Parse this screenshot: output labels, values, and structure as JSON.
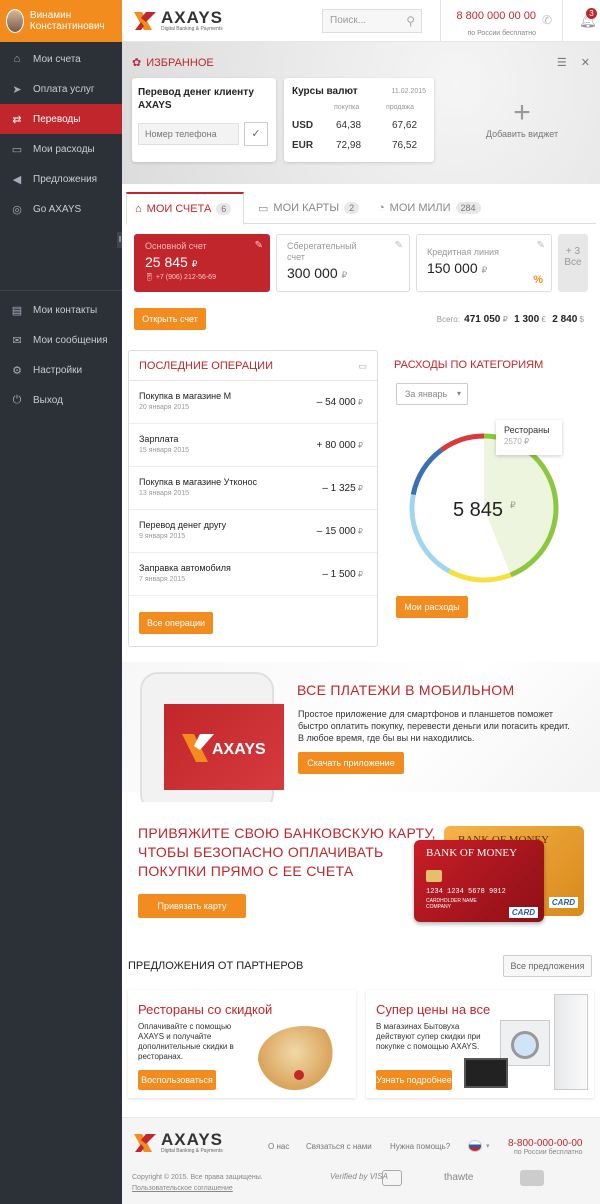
{
  "user": {
    "name": "Винамин Константинович"
  },
  "sidebar": {
    "items": [
      {
        "label": "Мои счета",
        "icon": "bank-icon",
        "glyph": "⌂"
      },
      {
        "label": "Оплата услуг",
        "icon": "send-icon",
        "glyph": "➤"
      },
      {
        "label": "Переводы",
        "icon": "transfer-icon",
        "glyph": "⇄"
      },
      {
        "label": "Мои расходы",
        "icon": "wallet-icon",
        "glyph": "▭"
      },
      {
        "label": "Предложения",
        "icon": "megaphone-icon",
        "glyph": "◀"
      },
      {
        "label": "Go AXAYS",
        "icon": "go-icon",
        "glyph": "◎"
      }
    ],
    "items2": [
      {
        "label": "Мои контакты",
        "icon": "contacts-icon",
        "glyph": "▤"
      },
      {
        "label": "Мои сообщения",
        "icon": "mail-icon",
        "glyph": "✉"
      },
      {
        "label": "Настройки",
        "icon": "gear-icon",
        "glyph": "⚙"
      },
      {
        "label": "Выход",
        "icon": "power-icon",
        "glyph": "⏻"
      }
    ],
    "active_index": 2
  },
  "header": {
    "logo": "AXAYS",
    "logo_sub": "Digital Banking & Payments",
    "search_placeholder": "Поиск...",
    "phone": "8 800 000 00 00",
    "phone_note": "по России бесплатно",
    "notifications": "3"
  },
  "favorites": {
    "title": "ИЗБРАННОЕ",
    "transfer_widget": {
      "title": "Перевод денег клиенту AXAYS",
      "placeholder": "Номер телефона"
    },
    "rates_widget": {
      "title": "Курсы валют",
      "date": "11.02.2015",
      "buy_label": "покупка",
      "sell_label": "продажа",
      "rows": [
        {
          "currency": "USD",
          "buy": "64,38",
          "sell": "67,62"
        },
        {
          "currency": "EUR",
          "buy": "72,98",
          "sell": "76,52"
        }
      ]
    },
    "add_widget": "Добавить виджет"
  },
  "tabs": [
    {
      "label": "МОИ СЧЕТА",
      "count": "6"
    },
    {
      "label": "МОИ КАРТЫ",
      "count": "2"
    },
    {
      "label": "МОИ МИЛИ",
      "count": "284"
    }
  ],
  "accounts": [
    {
      "name": "Основной счет",
      "value": "25 845",
      "currency": "₽",
      "sub": "+7 (906) 212-56-69"
    },
    {
      "name": "Сберегательный счет",
      "value": "300 000",
      "currency": "₽"
    },
    {
      "name": "Кредитная линия",
      "value": "150 000",
      "currency": "₽",
      "extra": "%"
    }
  ],
  "more_accounts": "+ 3 Все",
  "open_account": "Открыть счет",
  "totals": {
    "label": "Всего:",
    "rub": "471 050",
    "rub_cur": "₽",
    "eur": "1 300",
    "eur_cur": "€",
    "usd": "2 840",
    "usd_cur": "$"
  },
  "operations": {
    "title": "ПОСЛЕДНИЕ ОПЕРАЦИИ",
    "rows": [
      {
        "name": "Покупка в магазине М",
        "date": "20 января 2015",
        "amount": "– 54 000",
        "cur": "₽"
      },
      {
        "name": "Зарплата",
        "date": "15 января 2015",
        "amount": "+ 80 000",
        "cur": "₽"
      },
      {
        "name": "Покупка в магазине Утконос",
        "date": "13 января 2015",
        "amount": "– 1 325",
        "cur": "₽"
      },
      {
        "name": "Перевод денег другу",
        "date": "9 января 2015",
        "amount": "– 15 000",
        "cur": "₽"
      },
      {
        "name": "Заправка автомобиля",
        "date": "7 января 2015",
        "amount": "– 1 500",
        "cur": "₽"
      }
    ],
    "all_button": "Все операции"
  },
  "categories": {
    "title": "РАСХОДЫ ПО КАТЕГОРИЯМ",
    "period": "За январь",
    "total": "5 845",
    "total_cur": "₽",
    "tooltip_name": "Рестораны",
    "tooltip_value": "2570",
    "tooltip_cur": "₽",
    "button": "Мои расходы"
  },
  "chart_data": {
    "type": "pie",
    "total": 5845,
    "labels": [
      "Рестораны"
    ],
    "values": [
      2570
    ],
    "colors": [
      "#8dc63f",
      "#f7e03c",
      "#9fd6ee",
      "#3b6fb6",
      "#d93a3a"
    ]
  },
  "mobile_promo": {
    "title": "ВСЕ ПЛАТЕЖИ В МОБИЛЬНОМ",
    "text": "Простое приложение для смартфонов и планшетов поможет быстро оплатить покупку, перевести деньги или погасить кредит. В любое время, где бы вы ни находились.",
    "button": "Скачать приложение"
  },
  "card_promo": {
    "title_l1": "ПРИВЯЖИТЕ СВОЮ БАНКОВСКУЮ КАРТУ,",
    "title_l2": "ЧТОБЫ БЕЗОПАСНО ОПЛАЧИВАТЬ",
    "title_l3": "ПОКУПКИ ПРЯМО С ЕЕ СЧЕТА",
    "button": "Привязать карту",
    "card_bank": "BANK OF MONEY",
    "card_number": "1234 1234 5678 9012",
    "card_holder": "CARDHOLDER NAME",
    "card_company": "COMPANY",
    "card_brand": "CARD"
  },
  "partners": {
    "title": "ПРЕДЛОЖЕНИЯ ОТ ПАРТНЕРОВ",
    "all_button": "Все предложения",
    "offers": [
      {
        "title": "Рестораны со скидкой",
        "text": "Оплачивайте с помощью AXAYS и получайте дополнительные скидки в ресторанах.",
        "button": "Воспользоваться"
      },
      {
        "title": "Супер цены на все",
        "text": "В магазинах Бытовуха действуют супер скидки при покупке с помощью AXAYS.",
        "button": "Узнать подробнее"
      }
    ]
  },
  "footer": {
    "links": [
      "О нас",
      "Связаться с нами",
      "Нужна помощь?"
    ],
    "phone": "8-800-000-00-00",
    "phone_note": "по России бесплатно",
    "copyright": "Copyright © 2015. Все права защищены.",
    "agreement": "Пользовательское соглашение",
    "seals": [
      "Verified by VISA",
      "thawte"
    ]
  }
}
